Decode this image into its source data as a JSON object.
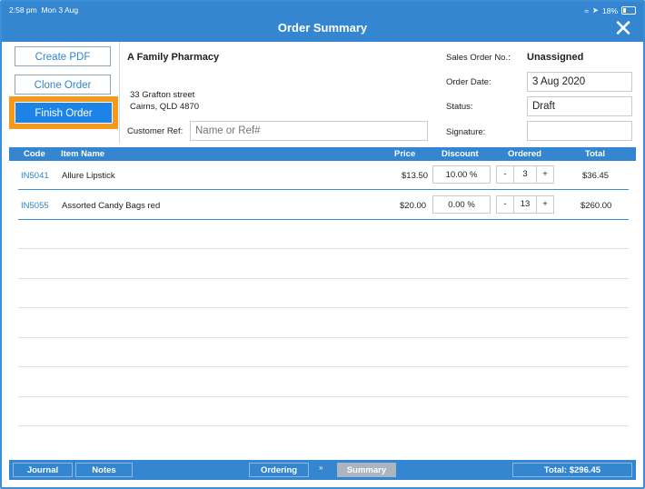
{
  "status_bar": {
    "time": "2:58 pm",
    "date": "Mon 3 Aug",
    "battery": "18%"
  },
  "header": {
    "title": "Order Summary"
  },
  "actions": {
    "create_pdf": "Create PDF",
    "clone_order": "Clone Order",
    "finish_order": "Finish Order"
  },
  "customer": {
    "name": "A Family Pharmacy",
    "address_line1": "33 Grafton street",
    "address_line2": "Cairns, QLD 4870",
    "ref_label": "Customer Ref:",
    "ref_placeholder": "Name or Ref#"
  },
  "order_info": {
    "sales_order_label": "Sales Order No.:",
    "sales_order_value": "Unassigned",
    "order_date_label": "Order Date:",
    "order_date_value": "3 Aug 2020",
    "status_label": "Status:",
    "status_value": "Draft",
    "signature_label": "Signature:"
  },
  "table": {
    "headers": {
      "code": "Code",
      "item_name": "Item Name",
      "price": "Price",
      "discount": "Discount",
      "ordered": "Ordered",
      "total": "Total"
    },
    "rows": [
      {
        "code": "IN5041",
        "name": "Allure Lipstick",
        "price": "$13.50",
        "discount": "10.00 %",
        "minus": "-",
        "qty": "3",
        "plus": "+",
        "total": "$36.45"
      },
      {
        "code": "IN5055",
        "name": "Assorted Candy Bags red",
        "price": "$20.00",
        "discount": "0.00 %",
        "minus": "-",
        "qty": "13",
        "plus": "+",
        "total": "$260.00"
      }
    ]
  },
  "footer": {
    "journal": "Journal",
    "notes": "Notes",
    "ordering": "Ordering",
    "chevron": "»",
    "summary": "Summary",
    "total": "Total: $296.45"
  },
  "colors": {
    "accent": "#3386cf",
    "highlight": "#f39a1e",
    "primary_button": "#1c84e8",
    "link": "#2f84d1"
  }
}
